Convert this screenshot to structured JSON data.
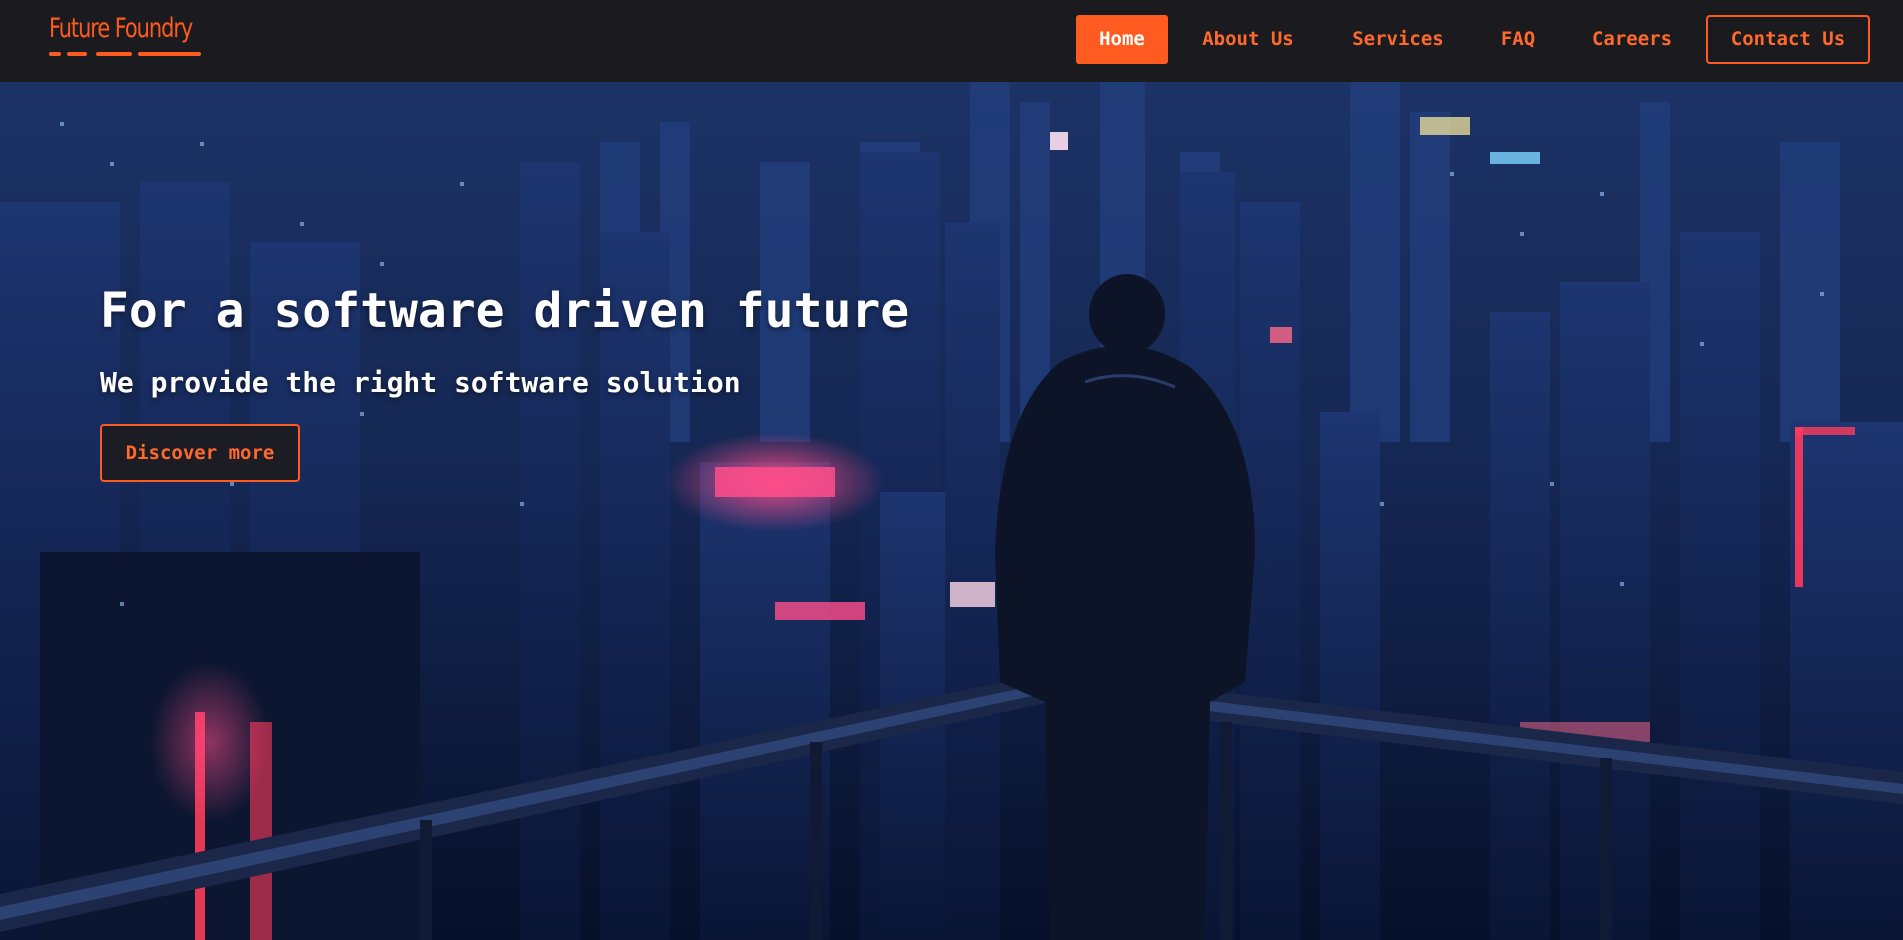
{
  "brand": {
    "name": "Future Foundry",
    "accent_color": "#ff5a1f"
  },
  "nav": {
    "items": [
      {
        "label": "Home",
        "active": true
      },
      {
        "label": "About Us"
      },
      {
        "label": "Services"
      },
      {
        "label": "FAQ"
      },
      {
        "label": "Careers"
      }
    ],
    "contact_label": "Contact Us"
  },
  "hero": {
    "title": "For a software driven future",
    "subtitle": "We provide the right software solution",
    "cta_label": "Discover more",
    "background_image": "night-city-skyline-person-on-balcony-image"
  }
}
